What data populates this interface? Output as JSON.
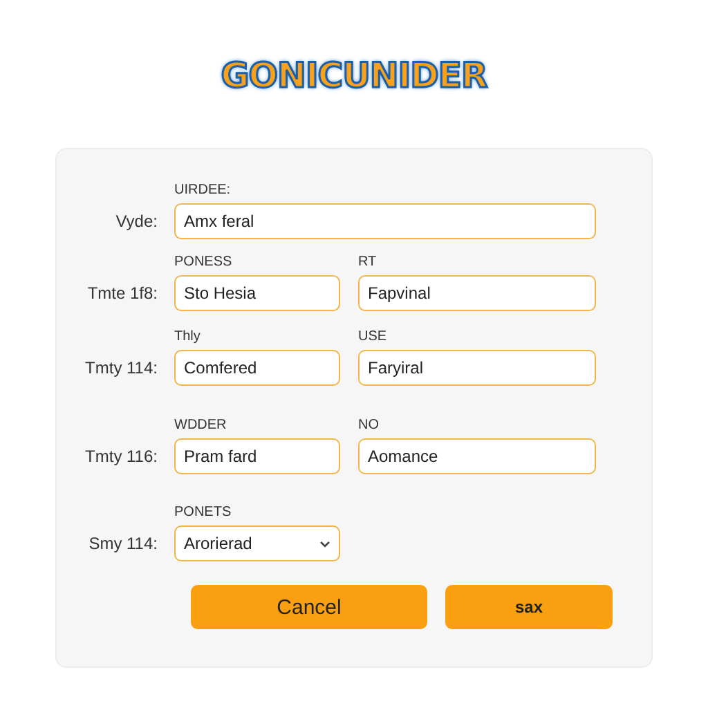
{
  "title": "GONICUNIDER",
  "rows": [
    {
      "label": "Vyde:",
      "fields": [
        {
          "kind": "text",
          "heading": "UIRDEE:",
          "value": "Amx feral"
        }
      ]
    },
    {
      "label": "Tmte 1f8:",
      "fields": [
        {
          "kind": "text",
          "heading": "PONESS",
          "value": "Sto Hesia"
        },
        {
          "kind": "text",
          "heading": "RT",
          "value": "Fapvinal"
        }
      ]
    },
    {
      "label": "Tmty 114:",
      "fields": [
        {
          "kind": "text",
          "heading": "Thly",
          "value": "Comfered"
        },
        {
          "kind": "text",
          "heading": "USE",
          "value": "Faryiral"
        }
      ]
    },
    {
      "label": "Tmty 116:",
      "fields": [
        {
          "kind": "text",
          "heading": "WDDER",
          "value": "Pram fard"
        },
        {
          "kind": "text",
          "heading": "NO",
          "value": "Aomance"
        }
      ]
    },
    {
      "label": "Smy 114:",
      "fields": [
        {
          "kind": "select",
          "heading": "PONETS",
          "value": "Arorierad"
        }
      ]
    }
  ],
  "buttons": [
    {
      "label": "Cancel",
      "kind": "secondary"
    },
    {
      "label": "sax",
      "kind": "primary"
    }
  ]
}
